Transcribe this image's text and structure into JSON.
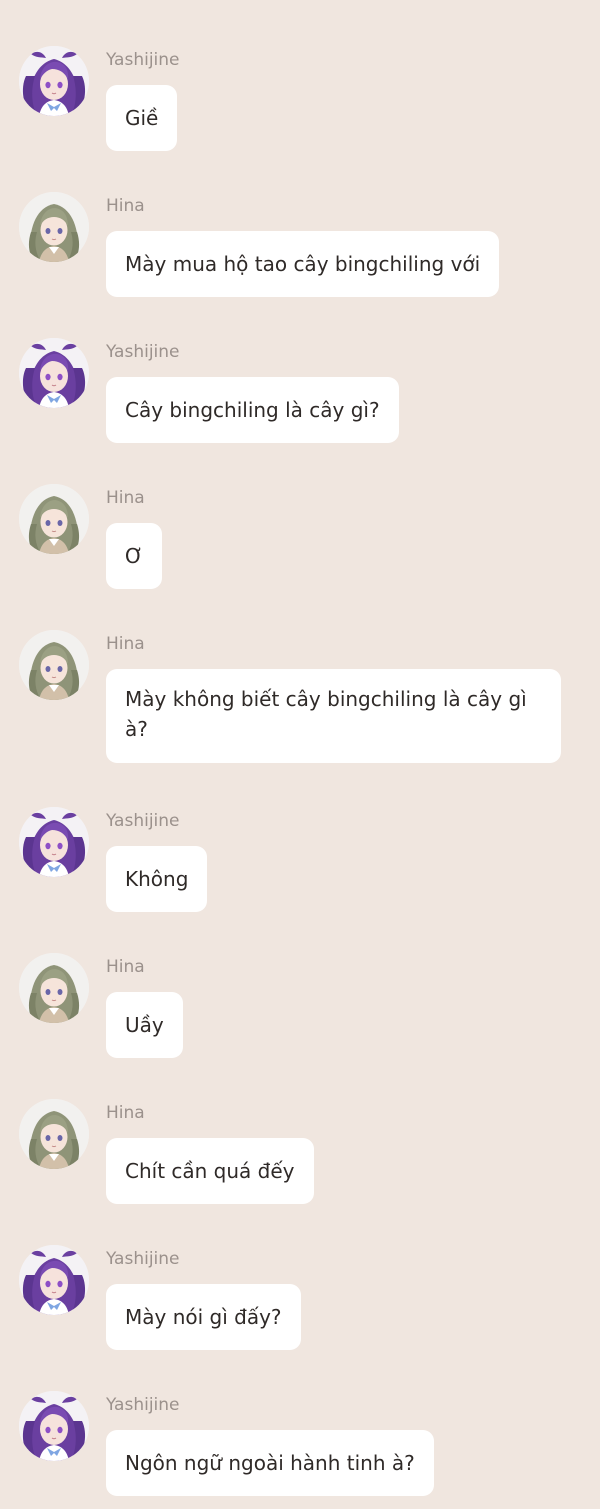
{
  "chat": {
    "messages": [
      {
        "sender": "Yashijine",
        "avatar": "yashijine-avatar-icon",
        "text": "Giề"
      },
      {
        "sender": "Hina",
        "avatar": "hina-avatar-icon",
        "text": "Mày mua hộ tao cây bingchiling với"
      },
      {
        "sender": "Yashijine",
        "avatar": "yashijine-avatar-icon",
        "text": "Cây bingchiling là cây gì?"
      },
      {
        "sender": "Hina",
        "avatar": "hina-avatar-icon",
        "text": "Ơ"
      },
      {
        "sender": "Hina",
        "avatar": "hina-avatar-icon",
        "text": "Mày không biết cây bingchiling là cây gì à?"
      },
      {
        "sender": "Yashijine",
        "avatar": "yashijine-avatar-icon",
        "text": "Không"
      },
      {
        "sender": "Hina",
        "avatar": "hina-avatar-icon",
        "text": "Uầy"
      },
      {
        "sender": "Hina",
        "avatar": "hina-avatar-icon",
        "text": "Chít cần quá đếy"
      },
      {
        "sender": "Yashijine",
        "avatar": "yashijine-avatar-icon",
        "text": "Mày nói gì đấy?"
      },
      {
        "sender": "Yashijine",
        "avatar": "yashijine-avatar-icon",
        "text": "Ngôn ngữ ngoài hành tinh à?"
      }
    ]
  },
  "colors": {
    "background": "#f0e6df",
    "bubble": "#ffffff",
    "sender_name": "#9b918c",
    "message_text": "#2f2a28"
  }
}
